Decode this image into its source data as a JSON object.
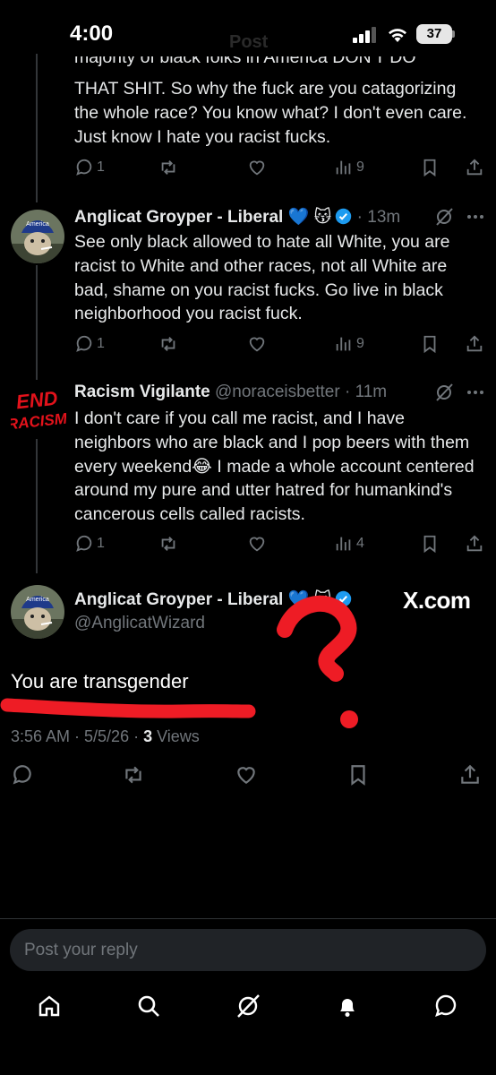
{
  "status_bar": {
    "time": "4:00",
    "battery": "37",
    "faded_title": "Post"
  },
  "thread": [
    {
      "partial_line": "majority of black folks in America DON'T DO",
      "text": "THAT SHIT. So why the fuck are you catagorizing the whole race? You know what? I don't even care. Just know I hate you racist fucks.",
      "replies": "1",
      "views": "9"
    },
    {
      "name": "Anglicat Groyper - Liberal 💙 😽",
      "meta": "· 13m",
      "avatar_text": "America",
      "text": "See only black allowed to hate all White, you are racist to White and other races, not all White are bad, shame on you racist fucks. Go live in black neighborhood you racist fuck.",
      "replies": "1",
      "views": "9"
    },
    {
      "name": "Racism Vigilante",
      "meta": "@noraceisbetter · 11m",
      "avatar_line1": "END",
      "avatar_line2": "RACISM",
      "text": "I don't care if you call me racist, and I have neighbors who are black and I pop beers with them every weekend😂 I made a whole account centered around my pure and utter hatred for humankind's cancerous cells called racists.",
      "replies": "1",
      "views": "4"
    }
  ],
  "main_post": {
    "name": "Anglicat Groyper - Liberal 💙 😽",
    "handle": "@AnglicatWizard",
    "avatar_text": "America",
    "text": "You are transgender",
    "timestamp": "3:56 AM · 5/5/26 · ",
    "views_count": "3",
    "views_label": " Views",
    "watermark": "X.com"
  },
  "reply_placeholder": "Post your reply",
  "colors": {
    "accent": "#1d9bf0",
    "annotation_red": "#ee1c25",
    "muted": "#71767b",
    "text": "#e7e9ea"
  }
}
